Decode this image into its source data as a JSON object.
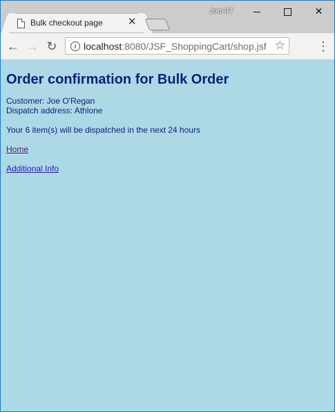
{
  "browser": {
    "tab": {
      "title": "Bulk checkout page",
      "close_glyph": "✕",
      "icon": "page-icon"
    },
    "profile_name": "JoeAIT",
    "address_bar": {
      "host": "localhost",
      "path": ":8080/JSF_ShoppingCart/shop.jsf",
      "icon": "info-icon"
    },
    "nav": {
      "back_glyph": "←",
      "forward_glyph": "→",
      "reload_glyph": "↻",
      "star_glyph": "☆",
      "menu_glyph": "⋮",
      "close_glyph": "✕"
    }
  },
  "page": {
    "heading": "Order confirmation for Bulk Order",
    "customer_line": "Customer: Joe O'Regan",
    "dispatch_line": "Dispatch address: Athlone",
    "dispatch_message": "Your 6 item(s) will be dispatched in the next 24 hours",
    "links": {
      "home": "Home",
      "additional_info": "Additional Info"
    }
  },
  "colors": {
    "page_background": "#add8e6",
    "heading_text": "#0b1f7a",
    "link": "#2a1ab2",
    "visited_link": "#4d1a80",
    "window_border": "#1979ca"
  }
}
